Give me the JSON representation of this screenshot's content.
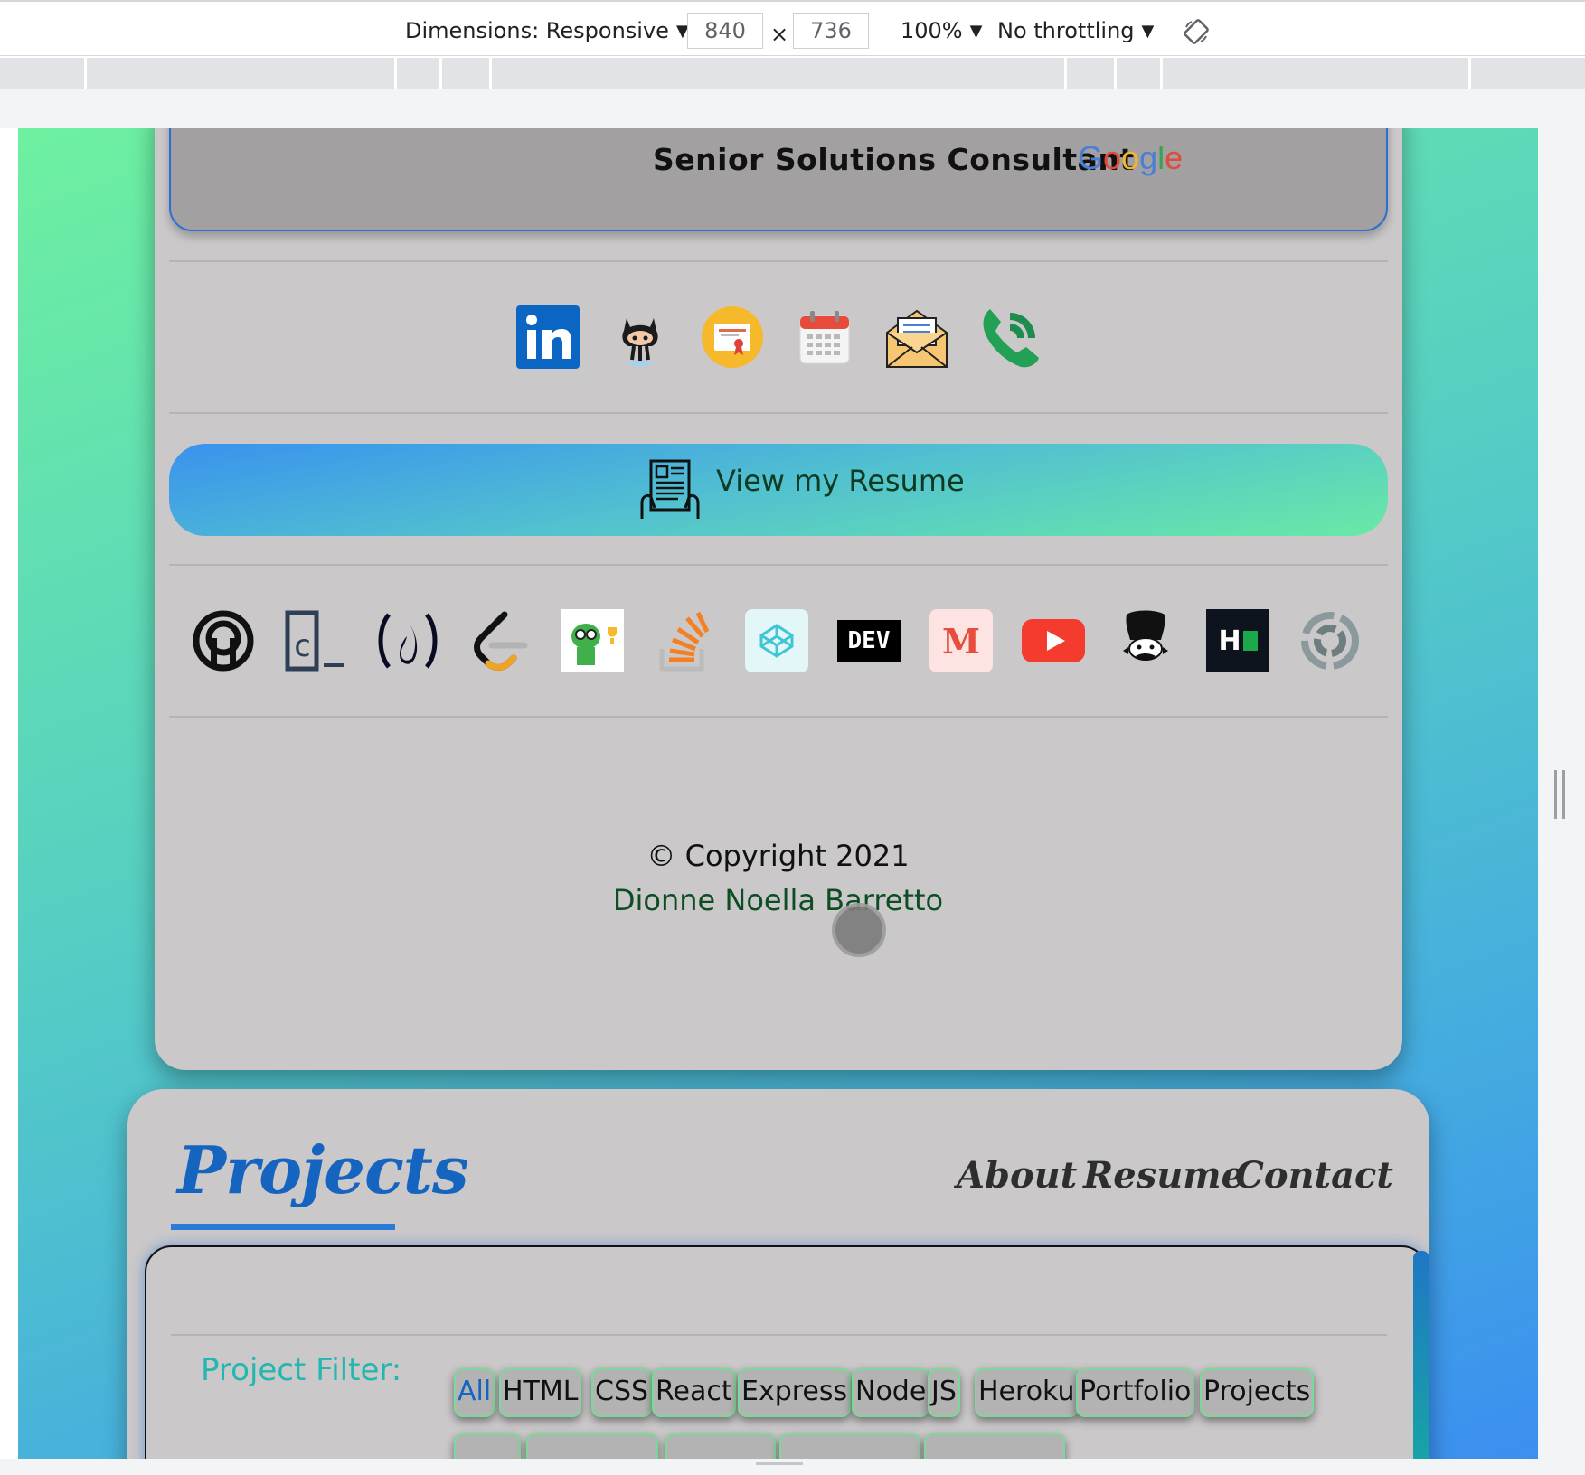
{
  "devtools": {
    "dimensions_label": "Dimensions: Responsive",
    "width_value": "840",
    "height_value": "736",
    "times": "×",
    "zoom": "100%",
    "throttling": "No throttling"
  },
  "profile": {
    "job_title": "Senior Solutions Consultant",
    "company_logo_text": "Google",
    "contact_icons": [
      "linkedin-icon",
      "github-icon",
      "certificate-icon",
      "calendar-icon",
      "email-icon",
      "phone-icon"
    ],
    "resume_button": "View my Resume",
    "platform_icons": [
      "codewars-icon",
      "coderbyte-icon",
      "freecodecamp-icon",
      "leetcode-icon",
      "codingame-icon",
      "stackoverflow-icon",
      "codepen-icon",
      "dev-icon",
      "medium-icon",
      "youtube-icon",
      "codechef-icon",
      "hackerrank-icon",
      "codesignal-icon"
    ],
    "dev_label": "DEV",
    "medium_label": "M",
    "hackerrank_label": "H",
    "copyright": "© Copyright 2021",
    "author": "Dionne Noella Barretto"
  },
  "projects": {
    "heading": "Projects",
    "nav": [
      "About",
      "Resume",
      "Contact"
    ],
    "filter_label": "Project Filter:",
    "filters": [
      "All",
      "HTML",
      "CSS",
      "React",
      "Express",
      "Node",
      "JS",
      "Heroku",
      "Portfolio",
      "Projects"
    ],
    "active_filter": "All"
  },
  "colors": {
    "accent_blue": "#1565c0",
    "card_gray": "#cac8c9",
    "filter_label": "#22b7b0",
    "author_green": "#0d4d23"
  }
}
